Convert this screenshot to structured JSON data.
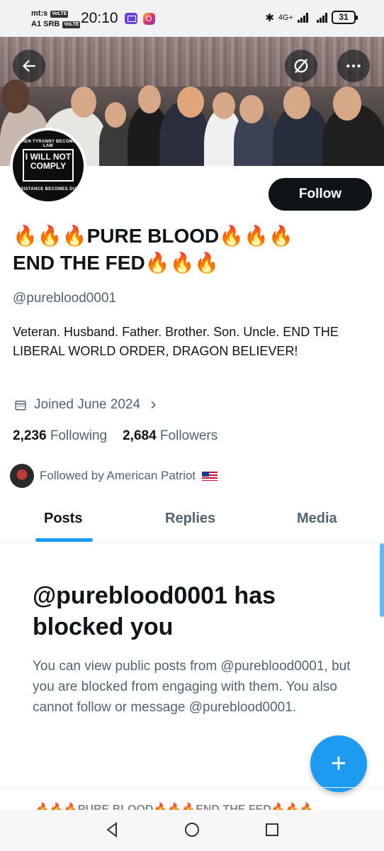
{
  "status_bar": {
    "carrier_top": "mt:s",
    "carrier_bottom": "A1 SRB",
    "volte": "VoLTE",
    "time": "20:10",
    "network": "4G+",
    "battery": "31"
  },
  "banner": {
    "back_icon": "arrow-left-icon",
    "grok_icon": "slash-circle-icon",
    "more_icon": "more-icon"
  },
  "avatar": {
    "ring_top": "WHEN TYRANNY BECOMES LAW",
    "center_text": "I WILL NOT COMPLY",
    "ring_bottom": "RESISTANCE BECOMES DUTY"
  },
  "follow_label": "Follow",
  "profile": {
    "name_line1": "🔥🔥🔥PURE BLOOD🔥🔥🔥",
    "name_line2": "END THE FED🔥🔥🔥",
    "handle": "@pureblood0001",
    "bio": "Veteran. Husband. Father. Brother. Son. Uncle. END THE LIBERAL WORLD ORDER, DRAGON BELIEVER!",
    "joined": "Joined June 2024",
    "following_count": "2,236",
    "following_label": "Following",
    "followers_count": "2,684",
    "followers_label": "Followers",
    "followed_by": "Followed by American Patriot"
  },
  "tabs": [
    "Posts",
    "Replies",
    "Media"
  ],
  "blocked": {
    "title": "@pureblood0001 has blocked you",
    "body": "You can view public posts from @pureblood0001, but you are blocked from engaging with them. You also cannot follow or message @pureblood0001."
  },
  "fab_label": "+",
  "peek_text": "🔥🔥🔥PURE BLOOD🔥🔥🔥END THE FED🔥🔥🔥",
  "colors": {
    "accent": "#1d9bf0",
    "text_primary": "#0f1419",
    "text_secondary": "#536471"
  }
}
